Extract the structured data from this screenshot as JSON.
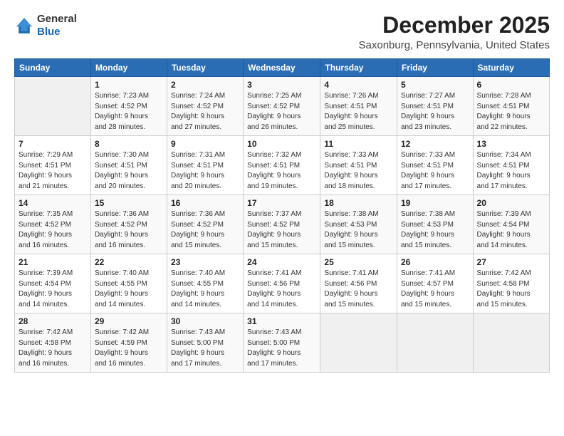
{
  "logo": {
    "line1": "General",
    "line2": "Blue"
  },
  "title": "December 2025",
  "subtitle": "Saxonburg, Pennsylvania, United States",
  "header_days": [
    "Sunday",
    "Monday",
    "Tuesday",
    "Wednesday",
    "Thursday",
    "Friday",
    "Saturday"
  ],
  "weeks": [
    [
      {
        "day": "",
        "info": ""
      },
      {
        "day": "1",
        "info": "Sunrise: 7:23 AM\nSunset: 4:52 PM\nDaylight: 9 hours\nand 28 minutes."
      },
      {
        "day": "2",
        "info": "Sunrise: 7:24 AM\nSunset: 4:52 PM\nDaylight: 9 hours\nand 27 minutes."
      },
      {
        "day": "3",
        "info": "Sunrise: 7:25 AM\nSunset: 4:52 PM\nDaylight: 9 hours\nand 26 minutes."
      },
      {
        "day": "4",
        "info": "Sunrise: 7:26 AM\nSunset: 4:51 PM\nDaylight: 9 hours\nand 25 minutes."
      },
      {
        "day": "5",
        "info": "Sunrise: 7:27 AM\nSunset: 4:51 PM\nDaylight: 9 hours\nand 23 minutes."
      },
      {
        "day": "6",
        "info": "Sunrise: 7:28 AM\nSunset: 4:51 PM\nDaylight: 9 hours\nand 22 minutes."
      }
    ],
    [
      {
        "day": "7",
        "info": "Sunrise: 7:29 AM\nSunset: 4:51 PM\nDaylight: 9 hours\nand 21 minutes."
      },
      {
        "day": "8",
        "info": "Sunrise: 7:30 AM\nSunset: 4:51 PM\nDaylight: 9 hours\nand 20 minutes."
      },
      {
        "day": "9",
        "info": "Sunrise: 7:31 AM\nSunset: 4:51 PM\nDaylight: 9 hours\nand 20 minutes."
      },
      {
        "day": "10",
        "info": "Sunrise: 7:32 AM\nSunset: 4:51 PM\nDaylight: 9 hours\nand 19 minutes."
      },
      {
        "day": "11",
        "info": "Sunrise: 7:33 AM\nSunset: 4:51 PM\nDaylight: 9 hours\nand 18 minutes."
      },
      {
        "day": "12",
        "info": "Sunrise: 7:33 AM\nSunset: 4:51 PM\nDaylight: 9 hours\nand 17 minutes."
      },
      {
        "day": "13",
        "info": "Sunrise: 7:34 AM\nSunset: 4:51 PM\nDaylight: 9 hours\nand 17 minutes."
      }
    ],
    [
      {
        "day": "14",
        "info": "Sunrise: 7:35 AM\nSunset: 4:52 PM\nDaylight: 9 hours\nand 16 minutes."
      },
      {
        "day": "15",
        "info": "Sunrise: 7:36 AM\nSunset: 4:52 PM\nDaylight: 9 hours\nand 16 minutes."
      },
      {
        "day": "16",
        "info": "Sunrise: 7:36 AM\nSunset: 4:52 PM\nDaylight: 9 hours\nand 15 minutes."
      },
      {
        "day": "17",
        "info": "Sunrise: 7:37 AM\nSunset: 4:52 PM\nDaylight: 9 hours\nand 15 minutes."
      },
      {
        "day": "18",
        "info": "Sunrise: 7:38 AM\nSunset: 4:53 PM\nDaylight: 9 hours\nand 15 minutes."
      },
      {
        "day": "19",
        "info": "Sunrise: 7:38 AM\nSunset: 4:53 PM\nDaylight: 9 hours\nand 15 minutes."
      },
      {
        "day": "20",
        "info": "Sunrise: 7:39 AM\nSunset: 4:54 PM\nDaylight: 9 hours\nand 14 minutes."
      }
    ],
    [
      {
        "day": "21",
        "info": "Sunrise: 7:39 AM\nSunset: 4:54 PM\nDaylight: 9 hours\nand 14 minutes."
      },
      {
        "day": "22",
        "info": "Sunrise: 7:40 AM\nSunset: 4:55 PM\nDaylight: 9 hours\nand 14 minutes."
      },
      {
        "day": "23",
        "info": "Sunrise: 7:40 AM\nSunset: 4:55 PM\nDaylight: 9 hours\nand 14 minutes."
      },
      {
        "day": "24",
        "info": "Sunrise: 7:41 AM\nSunset: 4:56 PM\nDaylight: 9 hours\nand 14 minutes."
      },
      {
        "day": "25",
        "info": "Sunrise: 7:41 AM\nSunset: 4:56 PM\nDaylight: 9 hours\nand 15 minutes."
      },
      {
        "day": "26",
        "info": "Sunrise: 7:41 AM\nSunset: 4:57 PM\nDaylight: 9 hours\nand 15 minutes."
      },
      {
        "day": "27",
        "info": "Sunrise: 7:42 AM\nSunset: 4:58 PM\nDaylight: 9 hours\nand 15 minutes."
      }
    ],
    [
      {
        "day": "28",
        "info": "Sunrise: 7:42 AM\nSunset: 4:58 PM\nDaylight: 9 hours\nand 16 minutes."
      },
      {
        "day": "29",
        "info": "Sunrise: 7:42 AM\nSunset: 4:59 PM\nDaylight: 9 hours\nand 16 minutes."
      },
      {
        "day": "30",
        "info": "Sunrise: 7:43 AM\nSunset: 5:00 PM\nDaylight: 9 hours\nand 17 minutes."
      },
      {
        "day": "31",
        "info": "Sunrise: 7:43 AM\nSunset: 5:00 PM\nDaylight: 9 hours\nand 17 minutes."
      },
      {
        "day": "",
        "info": ""
      },
      {
        "day": "",
        "info": ""
      },
      {
        "day": "",
        "info": ""
      }
    ]
  ]
}
